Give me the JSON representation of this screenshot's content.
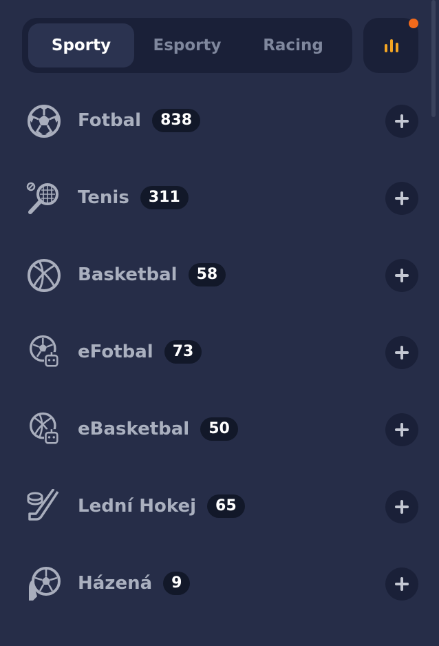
{
  "tabs": [
    {
      "label": "Sporty",
      "active": true
    },
    {
      "label": "Esporty",
      "active": false
    },
    {
      "label": "Racing",
      "active": false
    }
  ],
  "stats_button": {
    "icon": "bar-chart-icon",
    "notification": true,
    "accent": "#f5a623",
    "dot_color": "#f26a1b"
  },
  "sports": [
    {
      "name": "Fotbal",
      "count": "838",
      "icon": "soccer-ball-icon"
    },
    {
      "name": "Tenis",
      "count": "311",
      "icon": "tennis-racket-icon"
    },
    {
      "name": "Basketbal",
      "count": "58",
      "icon": "basketball-icon"
    },
    {
      "name": "eFotbal",
      "count": "73",
      "icon": "esoccer-robot-icon"
    },
    {
      "name": "eBasketbal",
      "count": "50",
      "icon": "ebasketball-robot-icon"
    },
    {
      "name": "Lední Hokej",
      "count": "65",
      "icon": "hockey-stick-puck-icon"
    },
    {
      "name": "Házená",
      "count": "9",
      "icon": "handball-icon"
    }
  ]
}
